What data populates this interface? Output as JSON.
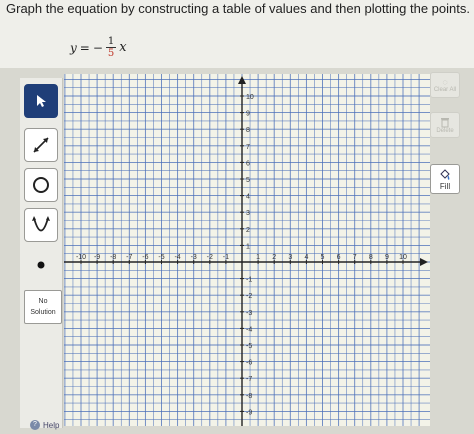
{
  "question": {
    "prompt": "Graph the equation by constructing a table of values and then plotting the points.",
    "equation": {
      "lhs": "y",
      "equals": "=",
      "sign": "−",
      "numerator": "1",
      "denominator": "5",
      "variable": "x"
    }
  },
  "left_tools": {
    "no_solution_line1": "No",
    "no_solution_line2": "Solution",
    "help_label": "Help"
  },
  "right_tools": {
    "clear_all_label": "Clear All",
    "delete_label": "Delete",
    "fill_label": "Fill"
  },
  "graph": {
    "x_range": [
      -10,
      10
    ],
    "y_range": [
      -10,
      10
    ],
    "grid_step": 0.5,
    "label_step": 1,
    "grid_color": "#4a6fb8",
    "axis_color": "#222222"
  },
  "colors": {
    "active_tool": "#1f3e78",
    "denominator": "#c0392b"
  }
}
